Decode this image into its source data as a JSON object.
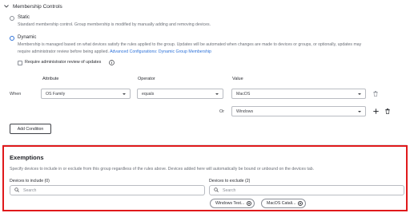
{
  "membership": {
    "title": "Membership Controls",
    "static": {
      "label": "Static",
      "description": "Standard membership control. Group membership is modified by manually adding and removing devices."
    },
    "dynamic": {
      "label": "Dynamic",
      "description_line1": "Membership is managed based on what devices satisfy the rules applied to the group. Updates will be automated when changes are made to devices or groups, or optionally, updates may",
      "description_line2_prefix": "require administrator review before being applied.",
      "link_text": "Advanced Configurations: Dynamic Group Membership"
    },
    "require_review_label": "Require administrator review of updates"
  },
  "rules": {
    "headers": {
      "attribute": "Attribute",
      "operator": "Operator",
      "value": "Value"
    },
    "row1": {
      "connector": "When",
      "attribute": "OS Family",
      "operator": "equals",
      "value": "MacOS"
    },
    "row2": {
      "connector": "Or",
      "value": "Windows"
    },
    "add_condition_label": "Add Condition"
  },
  "exemptions": {
    "title": "Exemptions",
    "description": "Specify devices to include in or exclude from this group regardless of the rules above. Devices added here will automatically be bound or unbound on the devices tab.",
    "include": {
      "label": "Devices to include (0)",
      "placeholder": "Search"
    },
    "exclude": {
      "label": "Devices to exclude (2)",
      "placeholder": "Search",
      "chips": [
        "Windows Test...",
        "MacOS Catali..."
      ]
    }
  },
  "colors": {
    "accent": "#2f73d9",
    "highlight_border": "#e0191b"
  },
  "icons": [
    "chevron-down-icon",
    "info-icon",
    "trash-icon",
    "plus-icon",
    "search-icon",
    "close-circle-icon"
  ]
}
